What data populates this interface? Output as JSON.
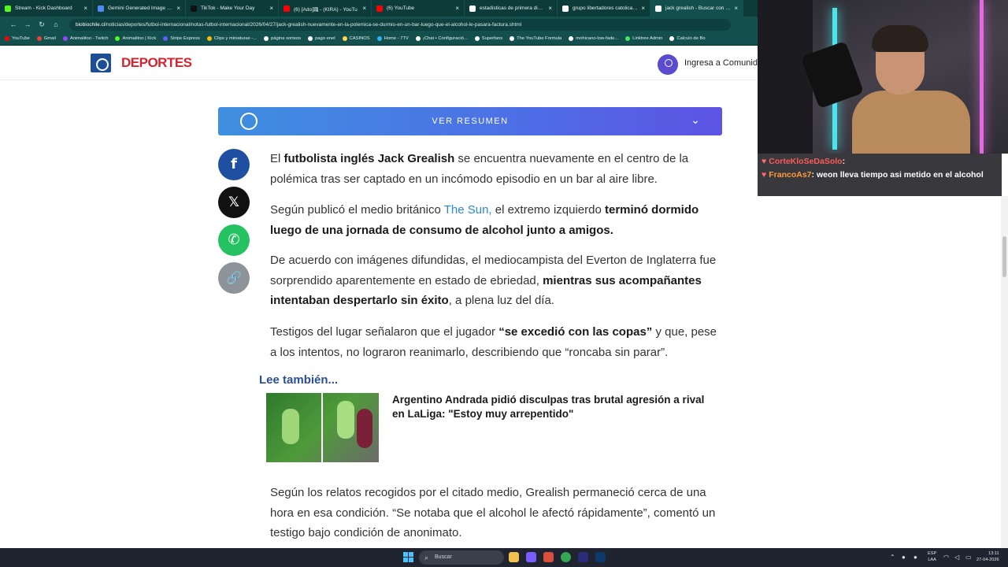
{
  "browser": {
    "tabs": [
      {
        "label": "Stream - Kick Dashboard",
        "color": "#53fc18"
      },
      {
        "label": "Gemini Generated Image pwz",
        "color": "#4d8df7"
      },
      {
        "label": "TikTok - Make Your Day",
        "color": "#111111"
      },
      {
        "label": "(6) [Ado]踊 - (KIRA) - YouTu",
        "color": "#ff0000"
      },
      {
        "label": "(6) YouTube",
        "color": "#ff0000"
      },
      {
        "label": "estadisticas de primera división",
        "color": "#ffffff"
      },
      {
        "label": "grupo libertadores catolica - B",
        "color": "#ffffff"
      },
      {
        "label": "jack grealish - Buscar con Goog",
        "color": "#ffffff"
      }
    ],
    "url_host": "biobiochile.cl",
    "url_path": "/noticias/deportes/futbol-internacional/notas-futbol-internacional/2026/04/27/jack-grealish-nuevamente-en-la-polemica-se-durmio-en-un-bar-luego-que-el-alcohol-le-pasara-factura.shtml",
    "bookmarks": [
      {
        "label": "YouTube",
        "color": "#ff0000"
      },
      {
        "label": "Gmail",
        "color": "#ea4335"
      },
      {
        "label": "Animalitoo - Twitch",
        "color": "#9146ff"
      },
      {
        "label": "Animalitoo | Kick",
        "color": "#53fc18"
      },
      {
        "label": "Stripe Express",
        "color": "#635bff"
      },
      {
        "label": "Clips y miniaturas -...",
        "color": "#fbbc04"
      },
      {
        "label": "página sorteos",
        "color": "#ffffff"
      },
      {
        "label": "pago enel",
        "color": "#ffffff"
      },
      {
        "label": "CASINOS",
        "color": "#ffd54f"
      },
      {
        "label": "Home - 7TV",
        "color": "#29b6f6"
      },
      {
        "label": "¡Chat • Configuració...",
        "color": "#ffffff"
      },
      {
        "label": "Superfans",
        "color": "#ffffff"
      },
      {
        "label": "The YouTube Formula",
        "color": "#ffffff"
      },
      {
        "label": "mohicano-low-fade...",
        "color": "#ffffff"
      },
      {
        "label": "Linktree Admin",
        "color": "#43e660"
      },
      {
        "label": "Calculo de Bo",
        "color": "#ffffff"
      }
    ]
  },
  "site": {
    "logo_text": "DEPORTES",
    "login_label": "Ingresa a Comunid"
  },
  "summary": {
    "label": "VER RESUMEN",
    "chevron_icon": "chevron-down-icon"
  },
  "share": {
    "facebook": "f",
    "x": "𝕏",
    "whatsapp": "✆",
    "link": "🔗"
  },
  "article": {
    "p1": {
      "t1": "El ",
      "b1": "futbolista inglés Jack Grealish",
      "t2": " se encuentra nuevamente en el centro de la polémica tras ser captado en un incómodo episodio en un bar al aire libre."
    },
    "p2": {
      "t1": "Según publicó el medio británico ",
      "link": "The Sun,",
      "t2": " el extremo izquierdo ",
      "b1": "terminó dormido luego de una jornada de consumo de alcohol junto a amigos."
    },
    "p3": {
      "t1": "De acuerdo con imágenes difundidas, el mediocampista del Everton de Inglaterra fue sorprendido aparentemente en estado de ebriedad, ",
      "b1": "mientras sus acompañantes intentaban despertarlo sin éxito",
      "t2": ", a plena luz del día."
    },
    "p4": {
      "t1": "Testigos del lugar señalaron que el jugador ",
      "b1": "“se excedió con las copas”",
      "t2": " y que, pese a los intentos, no lograron reanimarlo, describiendo que “roncaba sin parar”."
    },
    "lee_tambien": "Lee también...",
    "related_title": "Argentino Andrada pidió disculpas tras brutal agresión a rival en LaLiga: \"Estoy muy arrepentido\"",
    "p5": "Según los relatos recogidos por el citado medio, Grealish permaneció cerca de una hora en esa condición. “Se notaba que el alcohol le afectó rápidamente”, comentó un testigo bajo condición de anonimato."
  },
  "chat": {
    "line1_user": "CorteKloSeDaSolo",
    "line2_user": "FrancoAs7",
    "line2_msg": "weon lleva tiempo asi metido en el alcohol"
  },
  "taskbar": {
    "search_placeholder": "Buscar",
    "lang_line1": "ESP",
    "lang_line2": "LAA",
    "time": "13:11",
    "date": "27-04-2026"
  }
}
